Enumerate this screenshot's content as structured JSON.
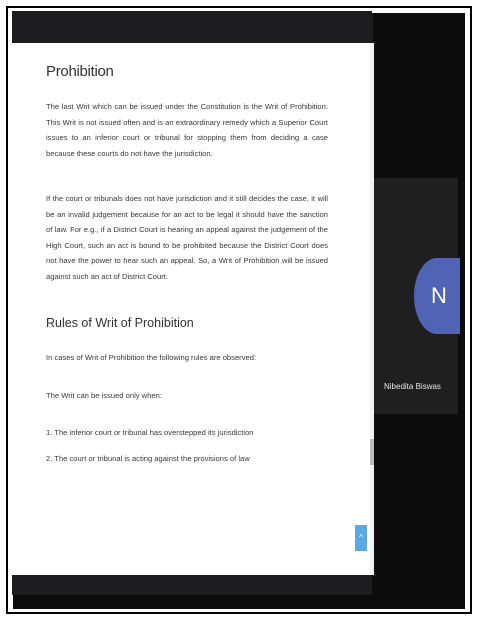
{
  "document": {
    "heading": "Prohibition",
    "para1": "The last Writ which can be issued under the Constitution is the Writ of Prohibition. This Writ is not issued often and is an extraordinary remedy which a Superior Court issues to an inferior court or tribunal for stopping them from deciding a case because these courts do not have the jurisdiction.",
    "para2": "If the court or tribunals does not have jurisdiction and it still decides the case, it will be an invalid judgement because for an act to be legal it should have the sanction of law. For e.g., if a District Court is hearing an appeal against the judgement of the High Court, such an act is bound to be prohibited because the District Court does not have the power to hear such an appeal. So, a Writ of Prohibition will be issued against such an act of District Court.",
    "subheading": "Rules of Writ of Prohibition",
    "para3": "In cases of Writ of Prohibition the following rules are observed:",
    "para4": "The Writ can be issued only when:",
    "item1": "1. The inferior court or tribunal has overstepped its jurisdiction",
    "item2": "2. The court or tribunal is acting against the provisions of law"
  },
  "participant": {
    "initial": "N",
    "name": "Nibedita Biswas",
    "avatar_color": "#5163b4"
  },
  "ui": {
    "scroll_top_glyph": "^"
  }
}
